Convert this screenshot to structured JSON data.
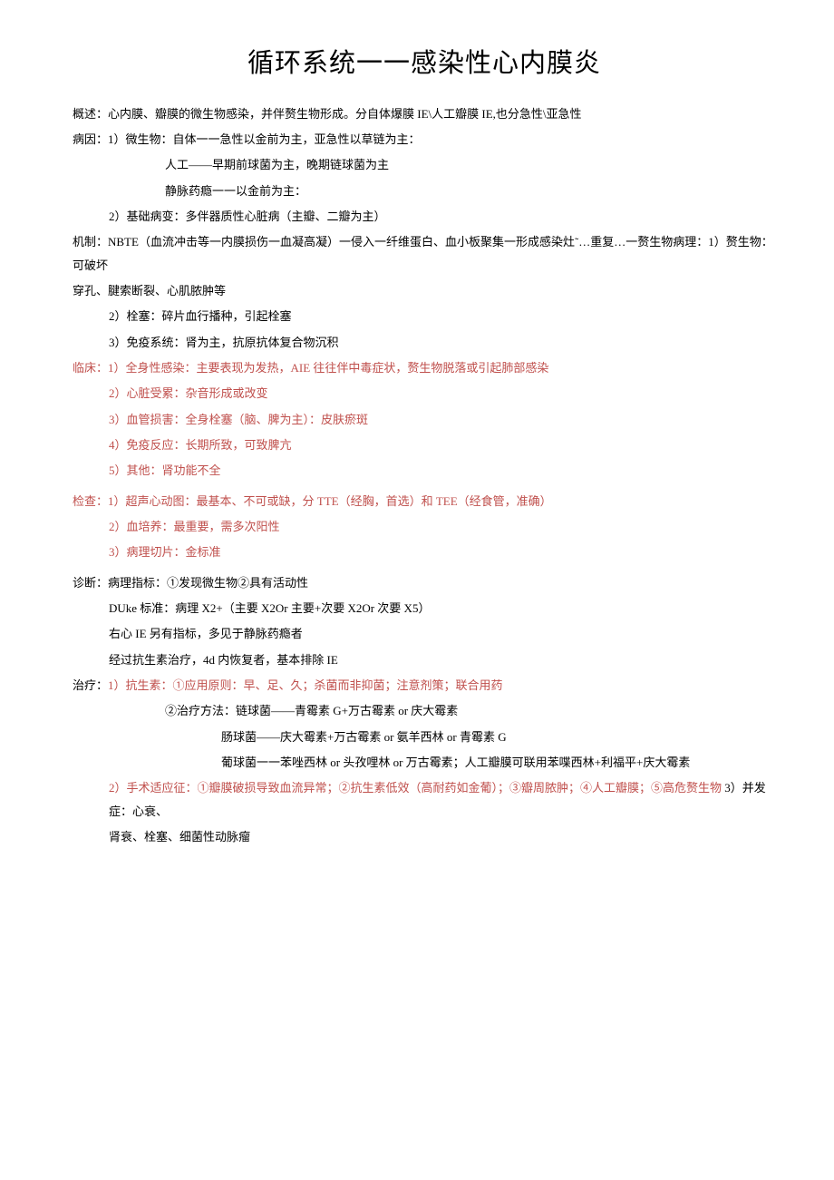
{
  "title": "循环系统一一感染性心内膜炎",
  "lines": {
    "l1": "概述：心内膜、瓣膜的微生物感染，并伴赘生物形成。分自体爆膜 IE\\人工瓣膜 IE,也分急性\\亚急性",
    "l2": "病因：1）微生物：自体一一急性以金前为主，亚急性以草链为主：",
    "l3": "人工——早期前球菌为主，晚期链球菌为主",
    "l4": "静脉药瘾一一以金前为主：",
    "l5": "2）基础病变：多伴器质性心脏病（主瓣、二瓣为主）",
    "l6": "机制：NBTE（血流冲击等一内膜损伤一血凝高凝）一侵入一纤维蛋白、血小板聚集一形成感染灶˜…重复…一赘生物病理：1）赘生物：可破坏",
    "l7": "穿孔、腱索断裂、心肌脓肿等",
    "l8": "2）栓塞：碎片血行播种，引起栓塞",
    "l9": "3）免疫系统：肾为主，抗原抗体复合物沉积",
    "l10": "临床：1）全身性感染：主要表现为发热，AIE 往往伴中毒症状，赘生物脱落或引起肺部感染",
    "l11": "2）心脏受累：杂音形成或改变",
    "l12": "3）血管损害：全身栓塞（脑、脾为主）：皮肤瘀斑",
    "l13": "4）免疫反应：长期所致，可致脾亢",
    "l14": "5）其他：肾功能不全",
    "l15": "检查：1）超声心动图：最基本、不可或缺，分 TTE（经胸，首选）和 TEE（经食管，准确）",
    "l16": "2）血培养：最重要，需多次阳性",
    "l17": "3）病理切片：金标准",
    "l18": "诊断：病理指标：①发现微生物②具有活动性",
    "l19": "DUke 标准：病理 X2+（主要 X2Or 主要+次要 X2Or 次要 X5）",
    "l20": "右心 IE 另有指标，多见于静脉药瘾者",
    "l21": "经过抗生素治疗，4d 内恢复者，基本排除 IE",
    "l22a": "治疗：",
    "l22b": "1）抗生素：①应用原则：早、足、久；杀菌而非抑菌；注意剂策；联合用药",
    "l23": "②治疗方法：链球菌——青霉素 G+万古霉素 or 庆大霉素",
    "l24": "肠球菌——庆大霉素+万古霉素 or 氨羊西林 or 青霉素 G",
    "l25": "葡球菌一一苯唑西林 or 头孜哩林 or 万古霉素；人工瓣膜可联用苯喋西林+利福平+庆大霉素",
    "l26a": "2）手术适应征：①瓣膜破损导致血流异常；②抗生素低效（高耐药如金葡）；③瓣周脓肿；④人工瓣膜；⑤高危赘生物",
    "l26b": " 3）并发症：心衰、",
    "l27": "肾衰、栓塞、细菌性动脉瘤"
  }
}
